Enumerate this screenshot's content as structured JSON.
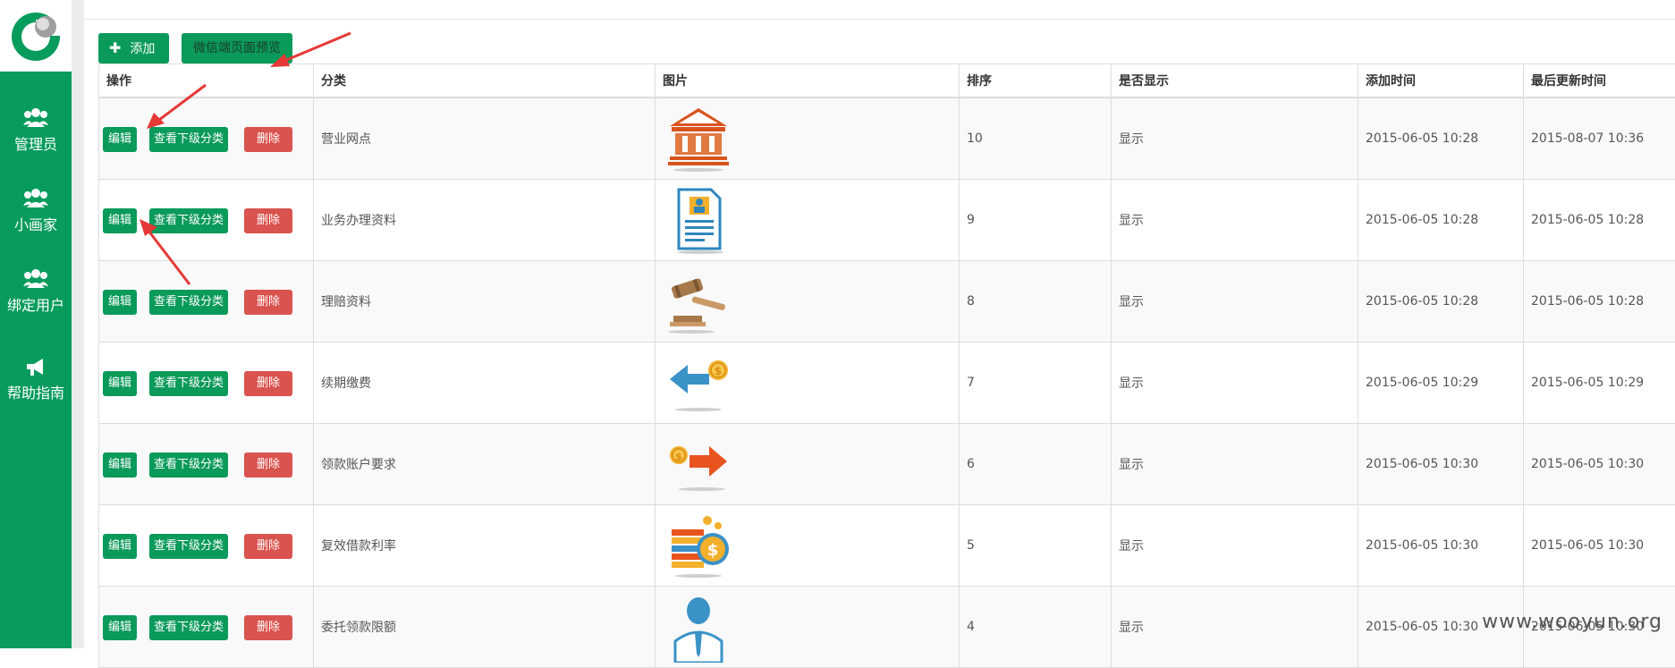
{
  "sidebar": {
    "items": [
      {
        "label": "管理员",
        "icon": "users-icon"
      },
      {
        "label": "小画家",
        "icon": "users-icon"
      },
      {
        "label": "绑定用户",
        "icon": "users-icon"
      },
      {
        "label": "帮助指南",
        "icon": "megaphone-icon"
      }
    ]
  },
  "toolbar": {
    "add_label": "添加",
    "preview_label": "微信端页面预览"
  },
  "table": {
    "headers": [
      "操作",
      "分类",
      "图片",
      "排序",
      "是否显示",
      "添加时间",
      "最后更新时间"
    ],
    "actions": {
      "edit": "编辑",
      "sub": "查看下级分类",
      "del": "删除"
    },
    "rows": [
      {
        "name": "营业网点",
        "icon": "bank-building-icon",
        "order": "10",
        "show": "显示",
        "added": "2015-06-05 10:28",
        "updated": "2015-08-07 10:36"
      },
      {
        "name": "业务办理资料",
        "icon": "document-profile-icon",
        "order": "9",
        "show": "显示",
        "added": "2015-06-05 10:28",
        "updated": "2015-06-05 10:28"
      },
      {
        "name": "理赔资料",
        "icon": "gavel-icon",
        "order": "8",
        "show": "显示",
        "added": "2015-06-05 10:28",
        "updated": "2015-06-05 10:28"
      },
      {
        "name": "续期缴费",
        "icon": "arrow-left-coin-icon",
        "order": "7",
        "show": "显示",
        "added": "2015-06-05 10:29",
        "updated": "2015-06-05 10:29"
      },
      {
        "name": "领款账户要求",
        "icon": "coin-arrow-right-icon",
        "order": "6",
        "show": "显示",
        "added": "2015-06-05 10:30",
        "updated": "2015-06-05 10:30"
      },
      {
        "name": "复效借款利率",
        "icon": "coins-stack-icon",
        "order": "5",
        "show": "显示",
        "added": "2015-06-05 10:30",
        "updated": "2015-06-05 10:30"
      },
      {
        "name": "委托领款限额",
        "icon": "person-icon",
        "order": "4",
        "show": "显示",
        "added": "2015-06-05 10:30",
        "updated": "2015-06-05 10:30"
      }
    ]
  },
  "colors": {
    "brand_green": "#079b5c",
    "danger_red": "#d9534f",
    "arrow_red": "#e53935"
  },
  "watermark": "www.wooyun.org"
}
